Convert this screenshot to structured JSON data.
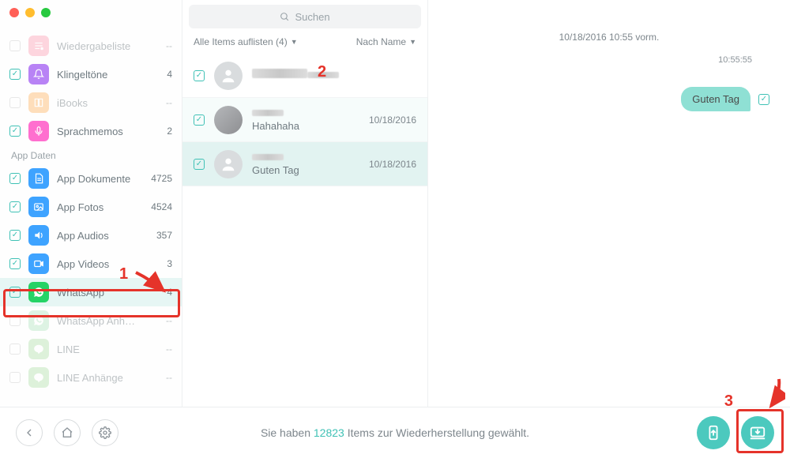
{
  "search": {
    "placeholder": "Suchen"
  },
  "filters": {
    "list": "Alle Items auflisten (4)",
    "sort": "Nach Name"
  },
  "sidebar": {
    "section_title": "App Daten",
    "items": [
      {
        "label": "Wiedergabeliste",
        "count": "--",
        "checked": false,
        "disabled": true,
        "icon": "playlist",
        "color": "#fca4b8"
      },
      {
        "label": "Klingeltöne",
        "count": "4",
        "checked": true,
        "disabled": false,
        "icon": "bell",
        "color": "#b883f5"
      },
      {
        "label": "iBooks",
        "count": "--",
        "checked": false,
        "disabled": true,
        "icon": "book",
        "color": "#ffb86b"
      },
      {
        "label": "Sprachmemos",
        "count": "2",
        "checked": true,
        "disabled": false,
        "icon": "mic",
        "color": "#ff6fcf"
      }
    ],
    "app_items": [
      {
        "label": "App Dokumente",
        "count": "4725",
        "checked": true,
        "disabled": false,
        "icon": "doc",
        "color": "#3ea3ff"
      },
      {
        "label": "App Fotos",
        "count": "4524",
        "checked": true,
        "disabled": false,
        "icon": "photo",
        "color": "#3ea3ff"
      },
      {
        "label": "App Audios",
        "count": "357",
        "checked": true,
        "disabled": false,
        "icon": "audio",
        "color": "#3ea3ff"
      },
      {
        "label": "App Videos",
        "count": "3",
        "checked": true,
        "disabled": false,
        "icon": "video",
        "color": "#3ea3ff"
      },
      {
        "label": "WhatsApp",
        "count": "4",
        "checked": true,
        "disabled": false,
        "icon": "whatsapp",
        "color": "#25d366",
        "active": true
      },
      {
        "label": "WhatsApp Anh…",
        "count": "--",
        "checked": false,
        "disabled": true,
        "icon": "whatsapp",
        "color": "#b7e7c4"
      },
      {
        "label": "LINE",
        "count": "--",
        "checked": false,
        "disabled": true,
        "icon": "line",
        "color": "#b6e2b0"
      },
      {
        "label": "LINE Anhänge",
        "count": "--",
        "checked": false,
        "disabled": true,
        "icon": "line",
        "color": "#b6e2b0"
      }
    ]
  },
  "chats": [
    {
      "name": "",
      "date": "",
      "checked": true,
      "selected": false,
      "has_photo": false
    },
    {
      "name": "Hahahaha",
      "date": "10/18/2016",
      "checked": true,
      "selected": false,
      "has_photo": true
    },
    {
      "name": "Guten Tag",
      "date": "10/18/2016",
      "checked": true,
      "selected": true,
      "has_photo": false
    }
  ],
  "conversation": {
    "date_header": "10/18/2016 10:55 vorm.",
    "messages": [
      {
        "time": "10:55:55",
        "text": "Guten Tag",
        "checked": true,
        "outgoing": true
      }
    ]
  },
  "footer": {
    "status_prefix": "Sie haben ",
    "status_count": "12823",
    "status_suffix": " Items zur Wiederherstellung gewählt."
  },
  "annotations": {
    "n1": "1",
    "n2": "2",
    "n3": "3"
  }
}
